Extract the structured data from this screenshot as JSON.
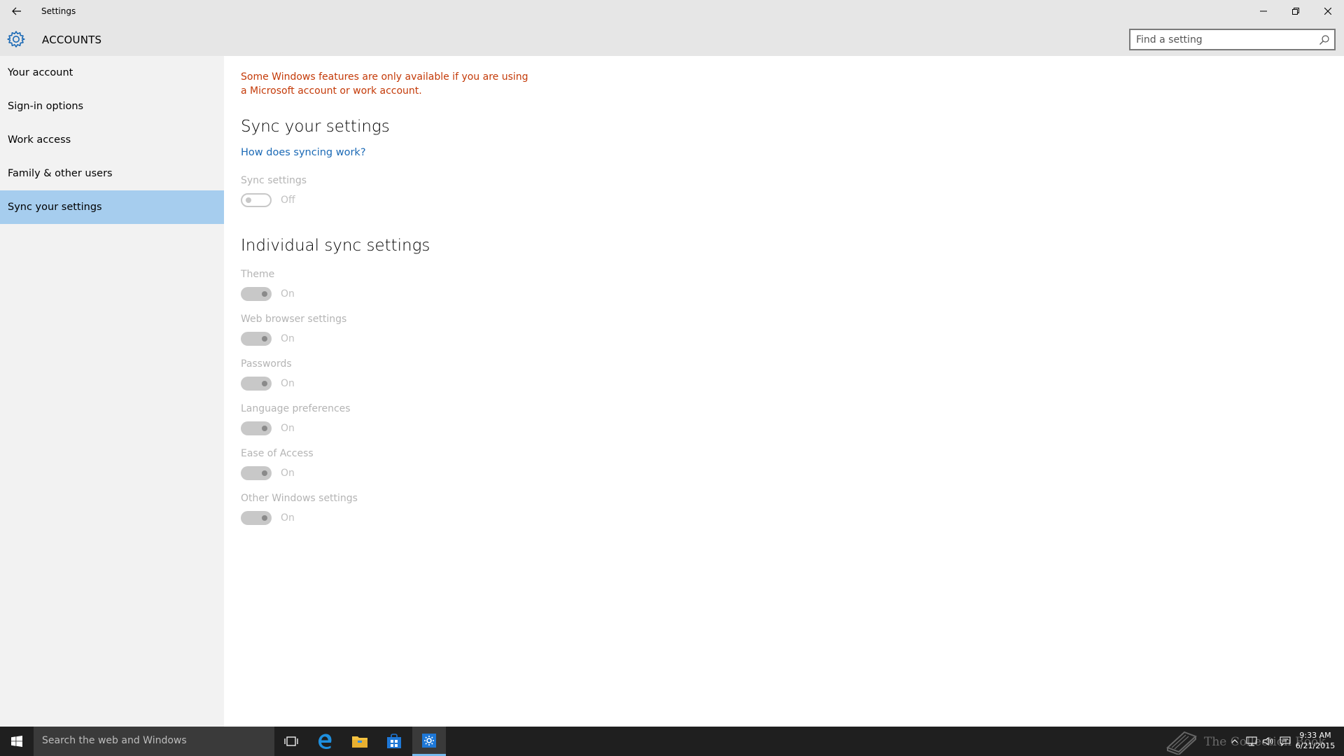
{
  "window": {
    "title": "Settings",
    "controls": [
      "minimize",
      "restore",
      "close"
    ]
  },
  "header": {
    "section_title": "ACCOUNTS",
    "search_placeholder": "Find a setting"
  },
  "sidebar": {
    "items": [
      {
        "label": "Your account",
        "active": false
      },
      {
        "label": "Sign-in options",
        "active": false
      },
      {
        "label": "Work access",
        "active": false
      },
      {
        "label": "Family & other users",
        "active": false
      },
      {
        "label": "Sync your settings",
        "active": true
      }
    ]
  },
  "content": {
    "warning": "Some Windows features are only available if you are using a Microsoft account or work account.",
    "sync_heading": "Sync your settings",
    "help_link": "How does syncing work?",
    "sync_setting": {
      "label": "Sync settings",
      "state": "Off"
    },
    "individual_heading": "Individual sync settings",
    "individual": [
      {
        "label": "Theme",
        "state": "On"
      },
      {
        "label": "Web browser settings",
        "state": "On"
      },
      {
        "label": "Passwords",
        "state": "On"
      },
      {
        "label": "Language preferences",
        "state": "On"
      },
      {
        "label": "Ease of Access",
        "state": "On"
      },
      {
        "label": "Other Windows settings",
        "state": "On"
      }
    ]
  },
  "taskbar": {
    "search_text": "Search the web and Windows",
    "watermark": "The Collection Book",
    "time": "9:33 AM",
    "date": "6/21/2015"
  },
  "colors": {
    "accent": "#0078d7",
    "active_nav": "#a6cdee",
    "warning": "#c43a08",
    "link": "#1a69b5"
  }
}
